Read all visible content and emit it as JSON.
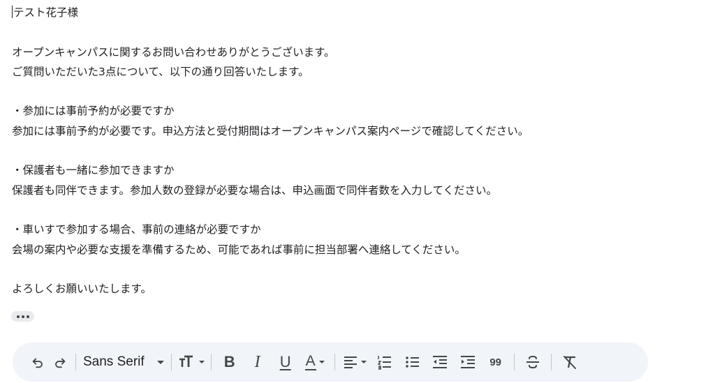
{
  "message": {
    "lines": [
      "テスト花子様",
      "",
      "オープンキャンパスに関するお問い合わせありがとうございます。",
      "ご質問いただいた3点について、以下の通り回答いたします。",
      "",
      "・参加には事前予約が必要ですか",
      "参加には事前予約が必要です。申込方法と受付期間はオープンキャンパス案内ページで確認してください。",
      "",
      "・保護者も一緒に参加できますか",
      "保護者も同伴できます。参加人数の登録が必要な場合は、申込画面で同伴者数を入力してください。",
      "",
      "・車いすで参加する場合、事前の連絡が必要ですか",
      "会場の案内や必要な支援を準備するため、可能であれば事前に担当部署へ連絡してください。",
      "",
      "よろしくお願いいたします。"
    ]
  },
  "toolbar": {
    "font_family_label": "Sans Serif",
    "quote_label": "99",
    "icons": [
      "undo-icon",
      "redo-icon",
      "text-size-icon",
      "bold-icon",
      "italic-icon",
      "underline-icon",
      "text-color-icon",
      "align-icon",
      "numbered-list-icon",
      "bulleted-list-icon",
      "indent-less-icon",
      "indent-more-icon",
      "quote-icon",
      "strikethrough-icon",
      "remove-formatting-icon"
    ],
    "bold_glyph": "B",
    "italic_glyph": "I",
    "underline_glyph": "U",
    "text_color_glyph": "A"
  },
  "colors": {
    "text": "#202124",
    "icon": "#444746",
    "toolbar_bg": "#f1f4f9",
    "trim_bg": "#e8eaed"
  }
}
